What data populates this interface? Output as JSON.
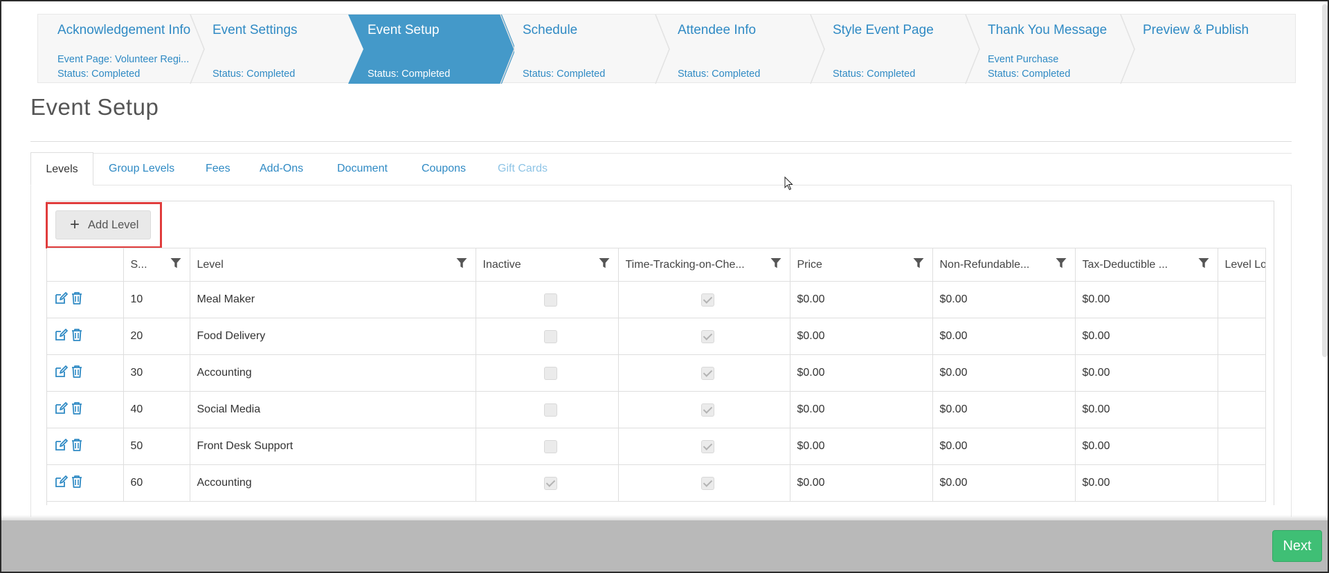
{
  "wizard": {
    "steps": [
      {
        "title": "Acknowledgement Info",
        "line1": "Event Page: Volunteer Regi...",
        "line2": "Status: Completed"
      },
      {
        "title": "Event Settings",
        "line1": "",
        "line2": "Status: Completed"
      },
      {
        "title": "Event Setup",
        "line1": "",
        "line2": "Status: Completed"
      },
      {
        "title": "Schedule",
        "line1": "",
        "line2": "Status: Completed"
      },
      {
        "title": "Attendee Info",
        "line1": "",
        "line2": "Status: Completed"
      },
      {
        "title": "Style Event Page",
        "line1": "",
        "line2": "Status: Completed"
      },
      {
        "title": "Thank You Message",
        "line1": "Event Purchase",
        "line2": "Status: Completed"
      },
      {
        "title": "Preview & Publish",
        "line1": "",
        "line2": ""
      }
    ],
    "active_index": 2,
    "active_color": "#4499c9"
  },
  "page": {
    "title": "Event Setup"
  },
  "tabs": [
    {
      "label": "Levels",
      "state": "active"
    },
    {
      "label": "Group Levels",
      "state": "normal"
    },
    {
      "label": "Fees",
      "state": "normal"
    },
    {
      "label": "Add-Ons",
      "state": "normal"
    },
    {
      "label": "Document",
      "state": "normal"
    },
    {
      "label": "Coupons",
      "state": "normal"
    },
    {
      "label": "Gift Cards",
      "state": "disabled"
    }
  ],
  "toolbar": {
    "add_level_label": "Add Level",
    "add_icon": "plus-icon",
    "highlight_color": "#e03c3c"
  },
  "grid": {
    "columns": [
      "",
      "S...",
      "Level",
      "Inactive",
      "Time-Tracking-on-Che...",
      "Price",
      "Non-Refundable...",
      "Tax-Deductible ...",
      "Level Lo"
    ],
    "rows": [
      {
        "sort": "10",
        "level": "Meal Maker",
        "inactive": false,
        "time_tracking": true,
        "price": "$0.00",
        "non_refundable": "$0.00",
        "tax_deductible": "$0.00"
      },
      {
        "sort": "20",
        "level": "Food Delivery",
        "inactive": false,
        "time_tracking": true,
        "price": "$0.00",
        "non_refundable": "$0.00",
        "tax_deductible": "$0.00"
      },
      {
        "sort": "30",
        "level": "Accounting",
        "inactive": false,
        "time_tracking": true,
        "price": "$0.00",
        "non_refundable": "$0.00",
        "tax_deductible": "$0.00"
      },
      {
        "sort": "40",
        "level": "Social Media",
        "inactive": false,
        "time_tracking": true,
        "price": "$0.00",
        "non_refundable": "$0.00",
        "tax_deductible": "$0.00"
      },
      {
        "sort": "50",
        "level": "Front Desk Support",
        "inactive": false,
        "time_tracking": true,
        "price": "$0.00",
        "non_refundable": "$0.00",
        "tax_deductible": "$0.00"
      },
      {
        "sort": "60",
        "level": "Accounting",
        "inactive": true,
        "time_tracking": true,
        "price": "$0.00",
        "non_refundable": "$0.00",
        "tax_deductible": "$0.00"
      }
    ]
  },
  "footer": {
    "next_label": "Next",
    "next_color": "#3fbf75"
  },
  "icons": {
    "edit": "edit-icon",
    "delete": "trash-icon",
    "filter": "filter-icon"
  }
}
